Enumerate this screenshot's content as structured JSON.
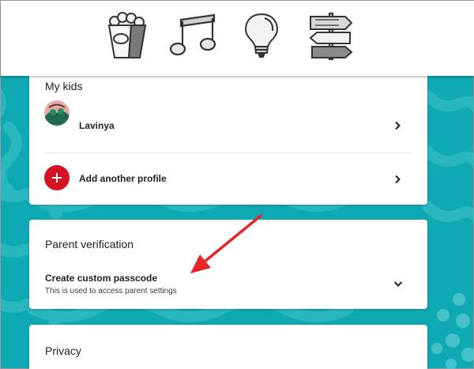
{
  "topbar": {
    "icons": [
      "popcorn-icon",
      "music-note-icon",
      "lightbulb-icon",
      "signpost-icon"
    ]
  },
  "kids_card": {
    "title": "My kids",
    "profiles": [
      {
        "name": "Lavinya"
      }
    ],
    "add_profile_label": "Add another profile"
  },
  "verification_card": {
    "title": "Parent verification",
    "passcode_label": "Create custom passcode",
    "passcode_description": "This is used to access parent settings"
  },
  "privacy_card": {
    "title": "Privacy"
  },
  "colors": {
    "background": "#0fa9b3",
    "accent_red": "#d51225",
    "annotation_arrow": "#e5262b"
  }
}
